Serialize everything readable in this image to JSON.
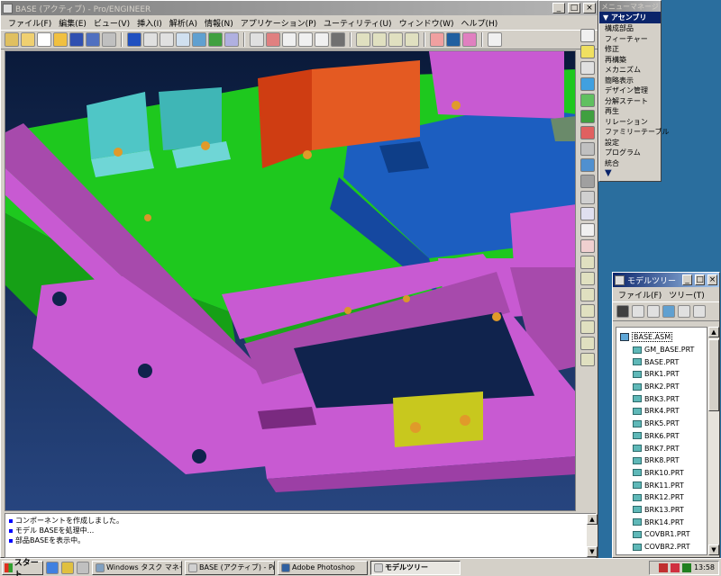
{
  "main_window": {
    "title": "BASE (アクティブ) - Pro/ENGINEER",
    "menus": [
      "ファイル(F)",
      "編集(E)",
      "ビュー(V)",
      "挿入(I)",
      "解析(A)",
      "情報(N)",
      "アプリケーション(P)",
      "ユーティリティ(U)",
      "ウィンドウ(W)",
      "ヘルプ(H)"
    ],
    "messages": [
      "コンポーネントを作成しました。",
      "モデル BASEを処理中...",
      "部品BASEを表示中。"
    ]
  },
  "menu_manager": {
    "title": "メニューマネージャ",
    "header": "アセンブリ",
    "items": [
      "構成部品",
      "フィーチャー",
      "修正",
      "再構築",
      "メカニズム",
      "簡略表示",
      "デザイン管理",
      "分解ステート",
      "再生",
      "リレーション",
      "ファミリーテーブル",
      "設定",
      "プログラム",
      "統合"
    ]
  },
  "model_tree": {
    "title": "モデルツリー",
    "menus": [
      "ファイル(F)",
      "ツリー(T)"
    ],
    "root": "BASE.ASM",
    "items": [
      "GM_BASE.PRT",
      "BASE.PRT",
      "BRK1.PRT",
      "BRK2.PRT",
      "BRK3.PRT",
      "BRK4.PRT",
      "BRK5.PRT",
      "BRK6.PRT",
      "BRK7.PRT",
      "BRK8.PRT",
      "BRK10.PRT",
      "BRK11.PRT",
      "BRK12.PRT",
      "BRK13.PRT",
      "BRK14.PRT",
      "COVBR1.PRT",
      "COVBR2.PRT"
    ]
  },
  "taskbar": {
    "start": "スタート",
    "buttons": [
      "Windows タスク マネージャ",
      "BASE (アクティブ) - Pro/E...",
      "Adobe Photoshop",
      "モデルツリー"
    ],
    "clock": "13:58"
  },
  "colors": {
    "viewport_bg": "#10234d",
    "green_part": "#1ec81e",
    "magenta_part": "#c85ad2",
    "blue_part": "#1c5ec0",
    "cyan_part": "#4fc6c6",
    "orange_part": "#cf3d12",
    "yellow_part": "#c8c81e"
  }
}
